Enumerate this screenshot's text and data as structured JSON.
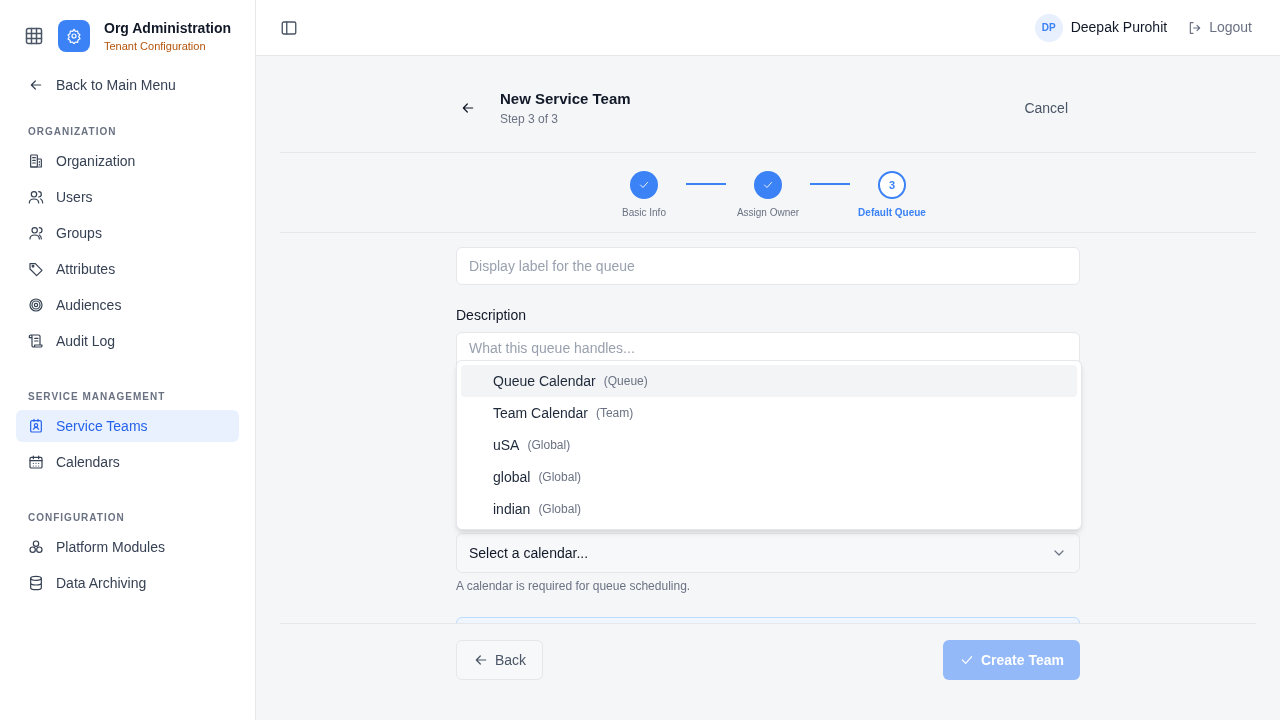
{
  "app": {
    "title": "Org Administration",
    "subtitle": "Tenant Configuration"
  },
  "back_link": "Back to Main Menu",
  "sidebar": {
    "sections": [
      {
        "heading": "ORGANIZATION",
        "items": [
          {
            "label": "Organization",
            "selected": false
          },
          {
            "label": "Users",
            "selected": false
          },
          {
            "label": "Groups",
            "selected": false
          },
          {
            "label": "Attributes",
            "selected": false
          },
          {
            "label": "Audiences",
            "selected": false
          },
          {
            "label": "Audit Log",
            "selected": false
          }
        ]
      },
      {
        "heading": "SERVICE MANAGEMENT",
        "items": [
          {
            "label": "Service Teams",
            "selected": true
          },
          {
            "label": "Calendars",
            "selected": false
          }
        ]
      },
      {
        "heading": "CONFIGURATION",
        "items": [
          {
            "label": "Platform Modules",
            "selected": false
          },
          {
            "label": "Data Archiving",
            "selected": false
          }
        ]
      }
    ]
  },
  "user": {
    "initials": "DP",
    "name": "Deepak Purohit",
    "logout": "Logout"
  },
  "wizard": {
    "title": "New Service Team",
    "step_text": "Step 3 of 3",
    "cancel": "Cancel",
    "steps": [
      {
        "label": "Basic Info",
        "completed": true,
        "selected": false
      },
      {
        "label": "Assign Owner",
        "completed": true,
        "selected": false
      },
      {
        "label": "Default Queue",
        "number": "3",
        "completed": false,
        "selected": true
      }
    ]
  },
  "form": {
    "queue_label_field": {
      "placeholder": "Display label for the queue"
    },
    "description": {
      "label": "Description",
      "placeholder": "What this queue handles..."
    },
    "calendar_select": {
      "value": "Select a calendar...",
      "helper": "A calendar is required for queue scheduling.",
      "expanded": true,
      "options": [
        {
          "name": "Queue Calendar",
          "scope": "(Queue)",
          "highlighted": true
        },
        {
          "name": "Team Calendar",
          "scope": "(Team)",
          "highlighted": false
        },
        {
          "name": "uSA",
          "scope": "(Global)",
          "highlighted": false
        },
        {
          "name": "global",
          "scope": "(Global)",
          "highlighted": false
        },
        {
          "name": "indian",
          "scope": "(Global)",
          "highlighted": false
        }
      ]
    }
  },
  "footer": {
    "back": "Back",
    "create": "Create Team",
    "create_disabled": true
  }
}
